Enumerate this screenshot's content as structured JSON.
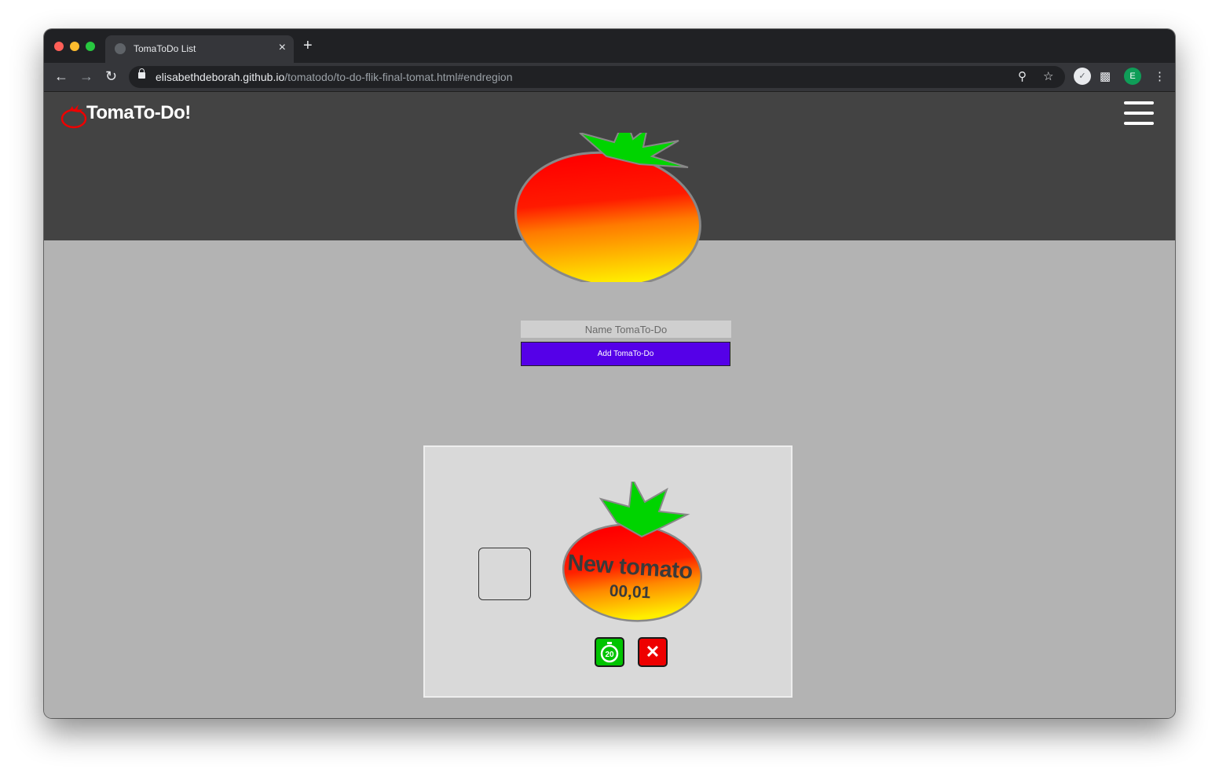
{
  "browser": {
    "tab_title": "TomaToDo List",
    "tab_close": "×",
    "new_tab": "+",
    "url_host": "elisabethdeborah.github.io",
    "url_path": "/tomatodo/to-do-flik-final-tomat.html#endregion",
    "profile_initial": "E"
  },
  "header": {
    "brand": "TomaTo-Do!"
  },
  "form": {
    "name_placeholder": "Name TomaTo-Do",
    "add_label": "Add TomaTo-Do"
  },
  "todo": {
    "name": "New tomato",
    "time": "00,01",
    "timer_badge": "20",
    "delete_symbol": "✕"
  },
  "colors": {
    "header_bg": "#434343",
    "page_bg": "#b3b3b3",
    "add_button": "#5500e8",
    "timer_button": "#00c400",
    "delete_button": "#ee0000",
    "tomato_red": "#ff0000",
    "tomato_yellow": "#ffe600",
    "leaf_green": "#00d400"
  }
}
